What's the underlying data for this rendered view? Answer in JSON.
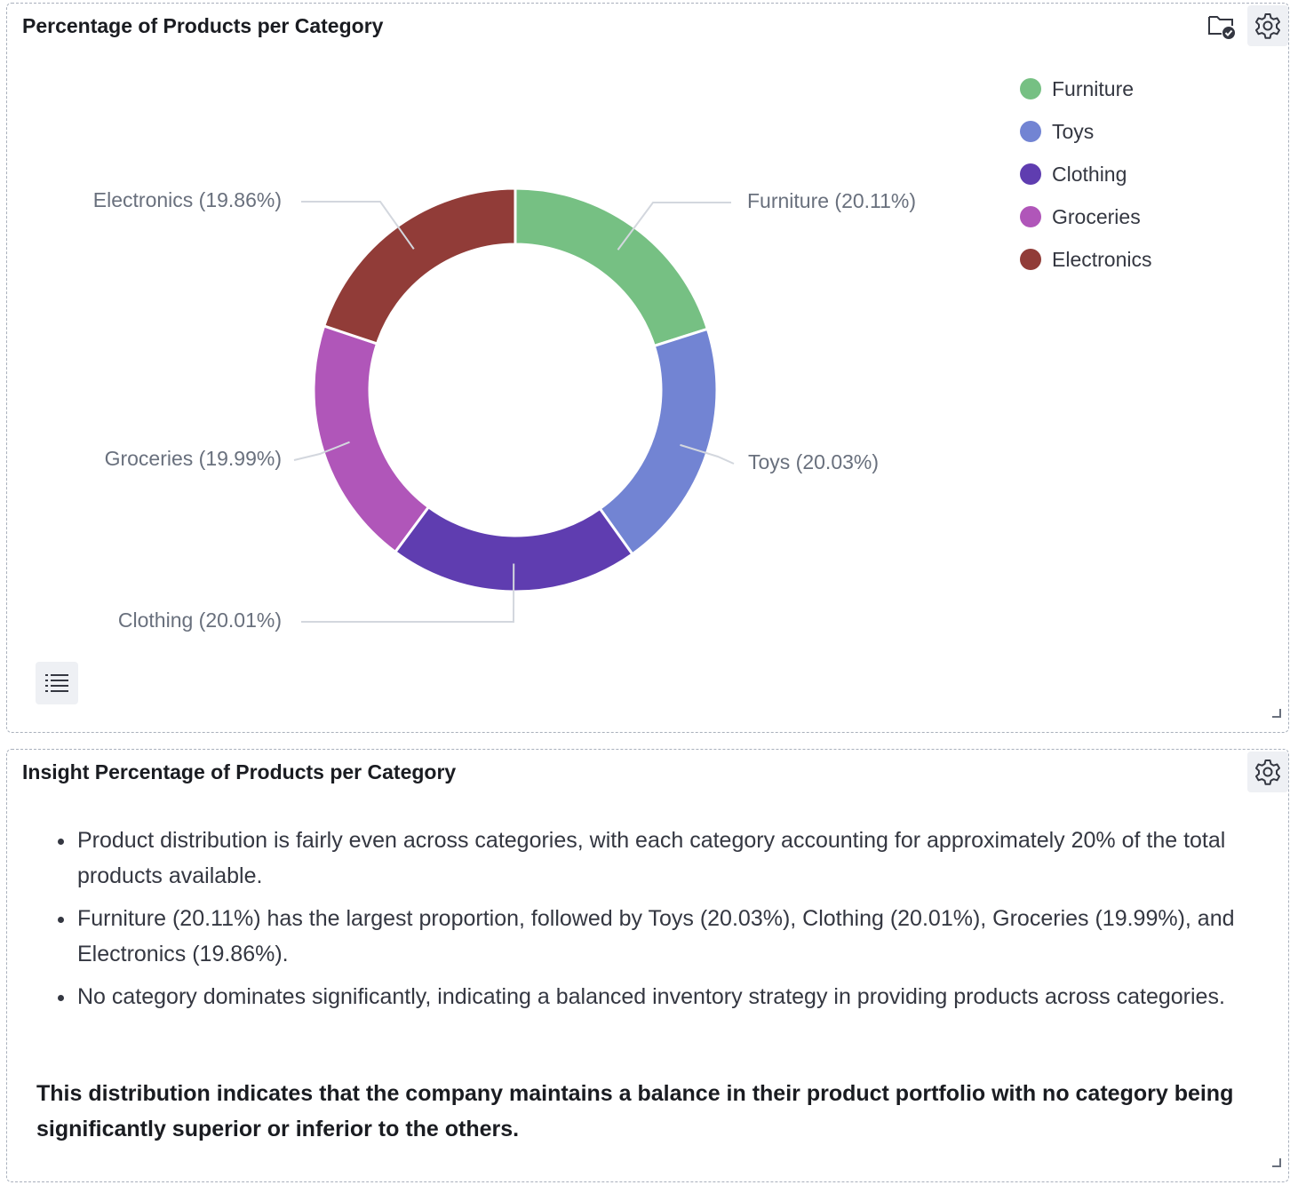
{
  "chart_panel": {
    "title": "Percentage of Products per Category"
  },
  "chart_data": {
    "type": "pie",
    "donut": true,
    "categories": [
      "Furniture",
      "Toys",
      "Clothing",
      "Groceries",
      "Electronics"
    ],
    "values": [
      20.11,
      20.03,
      20.01,
      19.99,
      19.86
    ],
    "unit": "%",
    "labels": [
      "Furniture (20.11%)",
      "Toys (20.03%)",
      "Clothing (20.01%)",
      "Groceries (19.99%)",
      "Electronics (19.86%)"
    ],
    "colors": [
      "#76c083",
      "#7284d3",
      "#5f3db0",
      "#b056b9",
      "#913c38"
    ],
    "legend": [
      "Furniture",
      "Toys",
      "Clothing",
      "Groceries",
      "Electronics"
    ],
    "legend_position": "top-right"
  },
  "insight_panel": {
    "title": "Insight Percentage of Products per Category",
    "bullets": [
      "Product distribution is fairly even across categories, with each category accounting for approximately 20% of the total products available.",
      "Furniture (20.11%) has the largest proportion, followed by Toys (20.03%), Clothing (20.01%), Groceries (19.99%), and Electronics (19.86%).",
      "No category dominates significantly, indicating a balanced inventory strategy in providing products across categories."
    ],
    "conclusion": "This distribution indicates that the company maintains a balance in their product portfolio with no category being significantly superior or inferior to the others."
  },
  "icons": {
    "gear": "gear-icon",
    "folder": "folder-check-icon",
    "list": "list-icon"
  }
}
